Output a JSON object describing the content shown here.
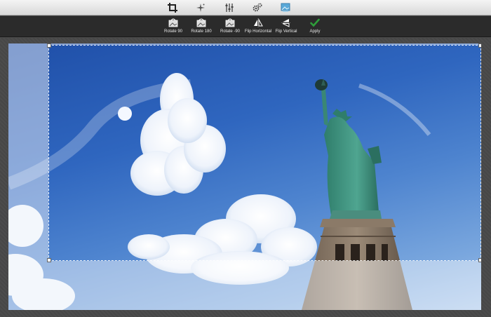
{
  "toolbar": {
    "tools": [
      {
        "icon": "crop-icon",
        "active": true
      },
      {
        "icon": "sparkle-icon",
        "active": false
      },
      {
        "icon": "sliders-icon",
        "active": false
      },
      {
        "icon": "gears-icon",
        "active": false
      },
      {
        "icon": "frame-icon",
        "active": false
      }
    ]
  },
  "actions": {
    "rotate90": "Rotate 90",
    "rotate180": "Rotate 180",
    "rotate_neg90": "Rotate -90",
    "flip_horizontal": "Flip Horizontal",
    "flip_vertical": "Flip Vertical",
    "apply": "Apply"
  },
  "colors": {
    "apply_check": "#2e9e3a",
    "toolbar_bg": "#e4e4e4",
    "actionbar_bg": "#2b2b2b"
  }
}
